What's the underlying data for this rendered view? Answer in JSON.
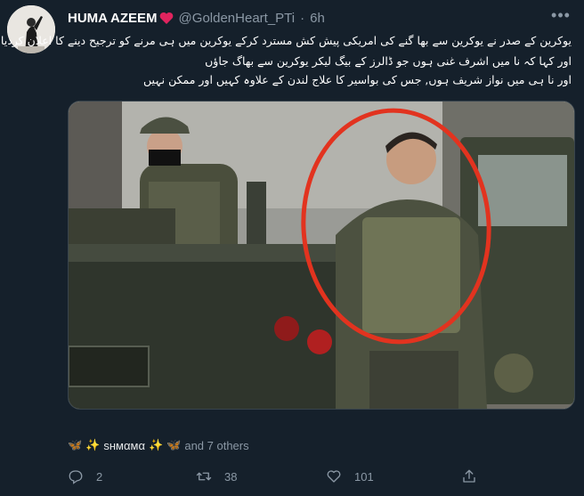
{
  "user": {
    "display_name": "HUMA AZEEM",
    "handle": "@GoldenHeart_PTi",
    "time": "6h"
  },
  "tweet": {
    "lines": [
      "یوکرین کے صدر نے یوکرین سے بھا گنے کی امریکی پیش کش مسترد کرکے یوکرین میں ہی مرنے کو ترجیح دینے کا اعلان کردیا",
      "اور کہا کہ نا میں اشرف غنی ہوں جو ڈالرز کے بیگ لیکر یوکرین سے بھاگ جاؤں",
      "اور نا ہی میں نواز شریف ہوں, جس کی بواسیر کا علاج لندن کے علاوہ کہیں اور ممکن نہیں"
    ]
  },
  "liked_by": {
    "name": "sнмαмα",
    "others": "and 7 others"
  },
  "actions": {
    "replies": "2",
    "retweets": "38",
    "likes": "101"
  },
  "colors": {
    "background": "#15202b",
    "secondary_text": "#8b98a5",
    "heart": "#e0245e",
    "annotation_circle": "#e2331f"
  }
}
